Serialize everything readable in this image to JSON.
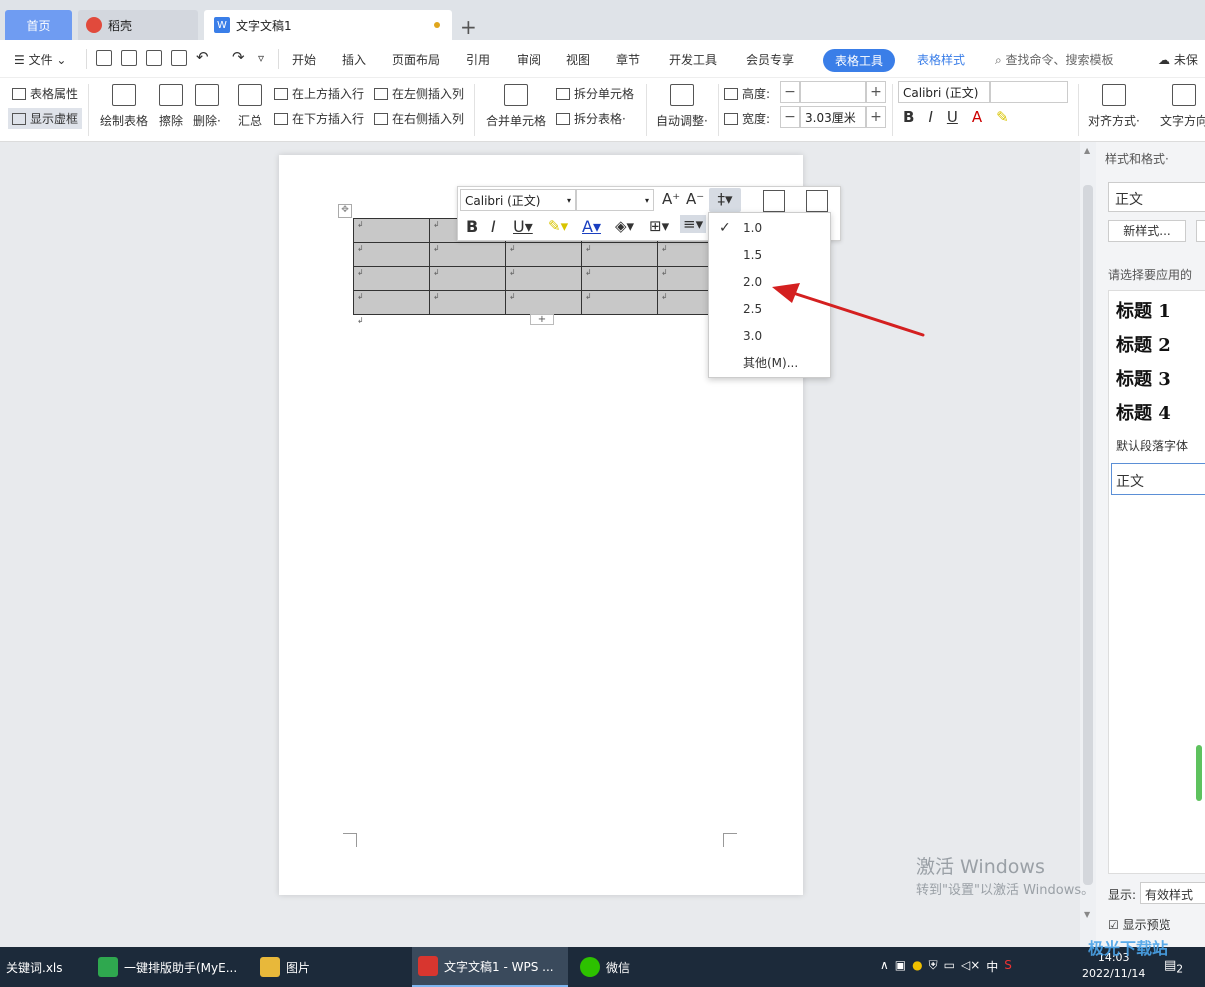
{
  "tabs": {
    "home": "首页",
    "daoke": "稻壳",
    "doc": "文字文稿1",
    "add": "+"
  },
  "menu": {
    "file": "文件",
    "start": "开始",
    "insert": "插入",
    "layout": "页面布局",
    "references": "引用",
    "review": "审阅",
    "view": "视图",
    "chapter": "章节",
    "dev_tools": "开发工具",
    "member": "会员专享",
    "table_tools": "表格工具",
    "table_style": "表格样式",
    "search": "查找命令、搜索模板",
    "cloud": "未保"
  },
  "ribbon": {
    "table_props": "表格属性",
    "show_gridlines": "显示虚框",
    "draw_table": "绘制表格",
    "erase": "擦除",
    "delete": "删除·",
    "summary": "汇总",
    "insert_above": "在上方插入行",
    "insert_below": "在下方插入行",
    "insert_left": "在左侧插入列",
    "insert_right": "在右侧插入列",
    "merge": "合并单元格",
    "split_cell": "拆分单元格",
    "split_table": "拆分表格·",
    "autofit": "自动调整·",
    "height_label": "高度:",
    "width_label": "宽度:",
    "height_value": "",
    "width_value": "3.03厘米",
    "font": "Calibri (正文)",
    "align": "对齐方式·",
    "text_dir": "文字方向"
  },
  "floatbar": {
    "font": "Calibri (正文)",
    "size": ""
  },
  "line_spacing": {
    "options": [
      "1.0",
      "1.5",
      "2.0",
      "2.5",
      "3.0",
      "其他(M)..."
    ],
    "selected": "1.0"
  },
  "cell_mark": "↲",
  "rpane": {
    "title": "样式和格式·",
    "current": "正文",
    "new_style": "新样式...",
    "prompt": "请选择要应用的",
    "styles": [
      "标题 1",
      "标题 2",
      "标题 3",
      "标题 4"
    ],
    "default_font": "默认段落字体",
    "normal": "正文",
    "show_label": "显示:",
    "show_value": "有效样式",
    "preview": "显示预览"
  },
  "activation": {
    "line1": "激活 Windows",
    "line2": "转到\"设置\"以激活 Windows。"
  },
  "taskbar": {
    "items": [
      "关键词.xls",
      "一键排版助手(MyE...",
      "图片",
      "文字文稿1 - WPS ...",
      "微信"
    ],
    "ime": "中",
    "time": "14:03",
    "date": "2022/11/14",
    "notifications": "2"
  },
  "watermark": "极光下载站"
}
